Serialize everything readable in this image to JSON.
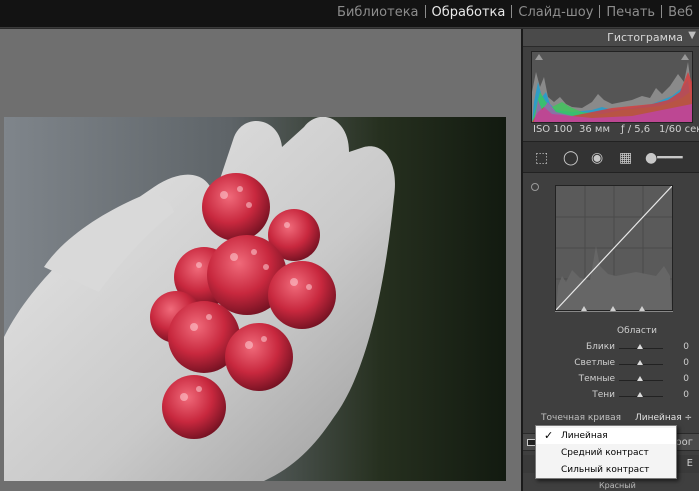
{
  "modules": [
    {
      "label": "Библиотека",
      "active": false
    },
    {
      "label": "Обработка",
      "active": true
    },
    {
      "label": "Слайд-шоу",
      "active": false
    },
    {
      "label": "Печать",
      "active": false
    },
    {
      "label": "Веб",
      "active": false
    }
  ],
  "histogram": {
    "title": "Гистограмма",
    "exif": {
      "iso": "ISO 100",
      "focal": "36 мм",
      "aperture": "ƒ / 5,6",
      "shutter": "1/60 сек"
    }
  },
  "tone_curve": {
    "regions_title": "Области",
    "regions": [
      {
        "label": "Блики",
        "value": "0"
      },
      {
        "label": "Светлые",
        "value": "0"
      },
      {
        "label": "Темные",
        "value": "0"
      },
      {
        "label": "Тени",
        "value": "0"
      }
    ],
    "point_curve_label": "Точечная кривая",
    "point_curve_colon": ":",
    "point_curve_value": "Линейная ÷"
  },
  "panels_below": {
    "next_panel_partial": "рог",
    "row2_partial": "Е",
    "row3_partial": "Красный"
  },
  "dropdown": {
    "items": [
      {
        "label": "Линейная",
        "checked": true,
        "check": "✓"
      },
      {
        "label": "Средний контраст",
        "checked": false,
        "check": ""
      },
      {
        "label": "Сильный контраст",
        "checked": false,
        "check": ""
      }
    ]
  }
}
